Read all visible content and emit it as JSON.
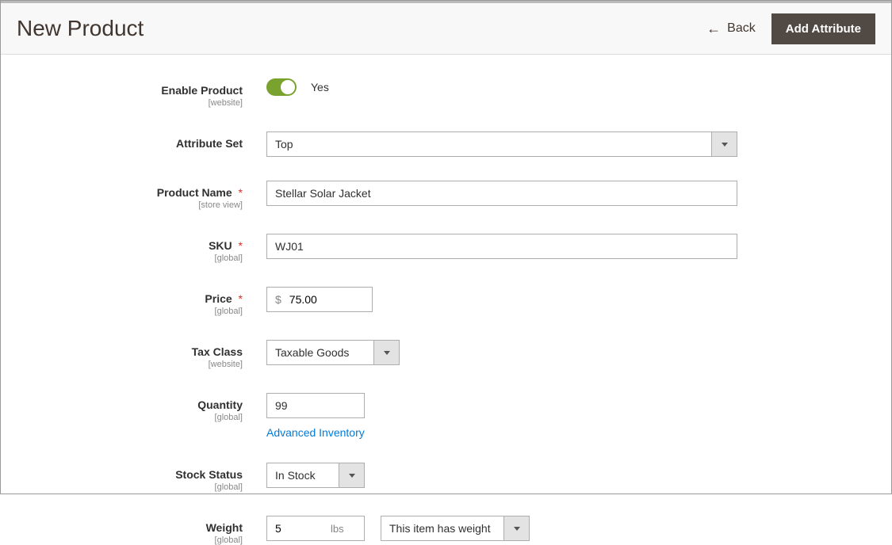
{
  "header": {
    "title": "New Product",
    "back_label": "Back",
    "add_attribute_label": "Add Attribute"
  },
  "labels": {
    "enable_product": "Enable Product",
    "attribute_set": "Attribute Set",
    "product_name": "Product Name",
    "sku": "SKU",
    "price": "Price",
    "tax_class": "Tax Class",
    "quantity": "Quantity",
    "stock_status": "Stock Status",
    "weight": "Weight"
  },
  "scopes": {
    "website": "[website]",
    "store_view": "[store view]",
    "global": "[global]"
  },
  "values": {
    "enable_product_state": "Yes",
    "attribute_set": "Top",
    "product_name": "Stellar Solar Jacket",
    "sku": "WJ01",
    "price_currency": "$",
    "price": "75.00",
    "tax_class": "Taxable Goods",
    "quantity": "99",
    "stock_status": "In Stock",
    "weight": "5",
    "weight_unit": "lbs",
    "weight_option": "This item has weight"
  },
  "links": {
    "advanced_inventory": "Advanced Inventory"
  }
}
